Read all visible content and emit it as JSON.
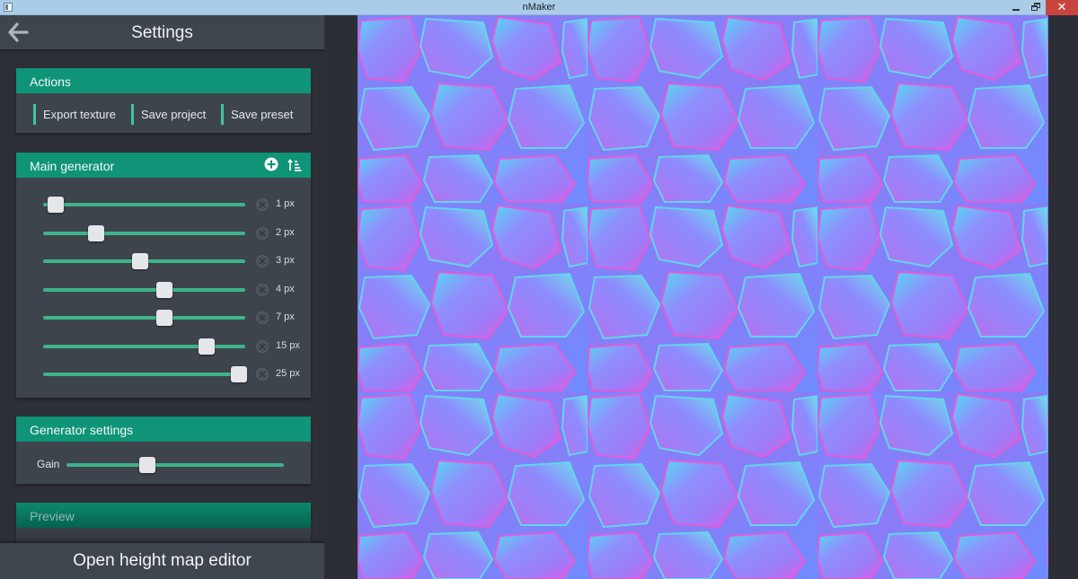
{
  "window": {
    "title": "nMaker"
  },
  "header": {
    "title": "Settings"
  },
  "actions": {
    "title": "Actions",
    "buttons": [
      "Export texture",
      "Save project",
      "Save preset"
    ]
  },
  "main_generator": {
    "title": "Main generator",
    "sliders": [
      {
        "label": "1 px",
        "value": 0.06
      },
      {
        "label": "2 px",
        "value": 0.26
      },
      {
        "label": "3 px",
        "value": 0.48
      },
      {
        "label": "4 px",
        "value": 0.6
      },
      {
        "label": "7 px",
        "value": 0.6
      },
      {
        "label": "15 px",
        "value": 0.81
      },
      {
        "label": "25 px",
        "value": 0.97
      }
    ]
  },
  "generator_settings": {
    "title": "Generator settings",
    "gain_label": "Gain",
    "gain_value": 0.37
  },
  "preview": {
    "title": "Preview"
  },
  "bottom": {
    "label": "Open height map editor"
  },
  "colors": {
    "accent": "#0f9478",
    "track": "#3fb38c",
    "panel": "#3e444c",
    "background": "#2c3036",
    "close": "#c7443f"
  },
  "icons": [
    "back-arrow-icon",
    "plus-circle-icon",
    "sort-ascending-icon",
    "remove-circle-icon",
    "window-minimize-icon",
    "window-restore-icon",
    "window-close-icon"
  ]
}
